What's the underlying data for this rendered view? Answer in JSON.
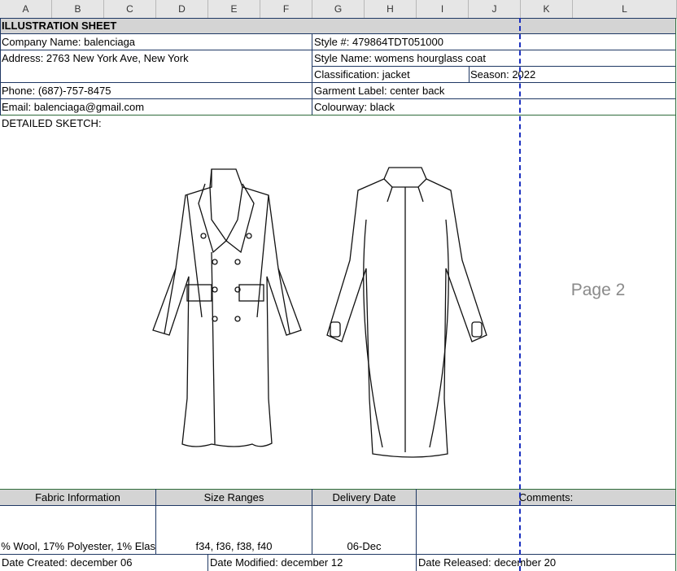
{
  "columns": [
    "A",
    "B",
    "C",
    "D",
    "E",
    "F",
    "G",
    "H",
    "I",
    "J",
    "K",
    "L"
  ],
  "sheet": {
    "title": "ILLUSTRATION SHEET",
    "company": "Company Name: balenciaga",
    "address": "Address: 2763 New York Ave, New York",
    "phone": "Phone:  (687)-757-8475",
    "email": "Email: balenciaga@gmail.com",
    "style_no": "Style #: 479864TDT051000",
    "style_name": "Style Name: womens hourglass coat",
    "classification": "Classification: jacket",
    "season": "Season: 2022",
    "garment_label": "Garment Label: center back",
    "colourway": "Colourway: black",
    "sketch_label": "DETAILED SKETCH:",
    "page_watermark": "Page 2"
  },
  "table": {
    "headers": [
      "Fabric Information",
      "Size Ranges",
      "Delivery Date",
      "Comments:"
    ],
    "values": [
      "% Wool, 17% Polyester, 1% Elas",
      "f34, f36, f38, f40",
      "06-Dec",
      ""
    ]
  },
  "dates": {
    "created": "Date Created: december 06",
    "modified": "Date Modified: december 12",
    "released": "Date Released: december 20"
  }
}
